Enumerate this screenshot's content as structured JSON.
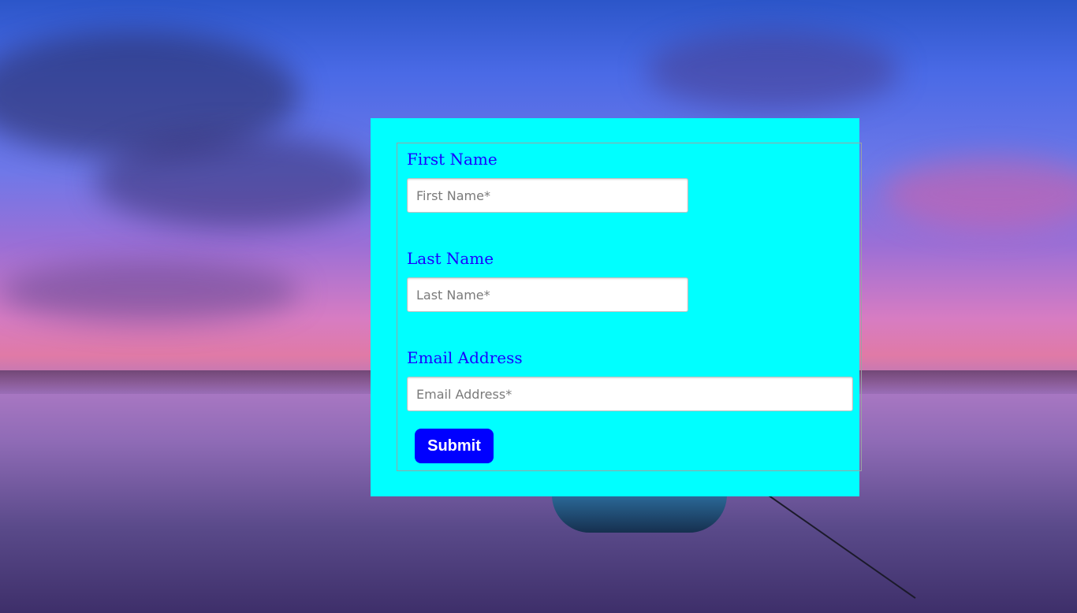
{
  "form": {
    "first_name": {
      "label": "First Name",
      "placeholder": "First Name*",
      "value": ""
    },
    "last_name": {
      "label": "Last Name",
      "placeholder": "Last Name*",
      "value": ""
    },
    "email": {
      "label": "Email Address",
      "placeholder": "Email Address*",
      "value": ""
    },
    "submit_label": "Submit"
  },
  "colors": {
    "card_background": "#00ffff",
    "label_text": "#1a00ff",
    "submit_button": "#0000ff"
  }
}
